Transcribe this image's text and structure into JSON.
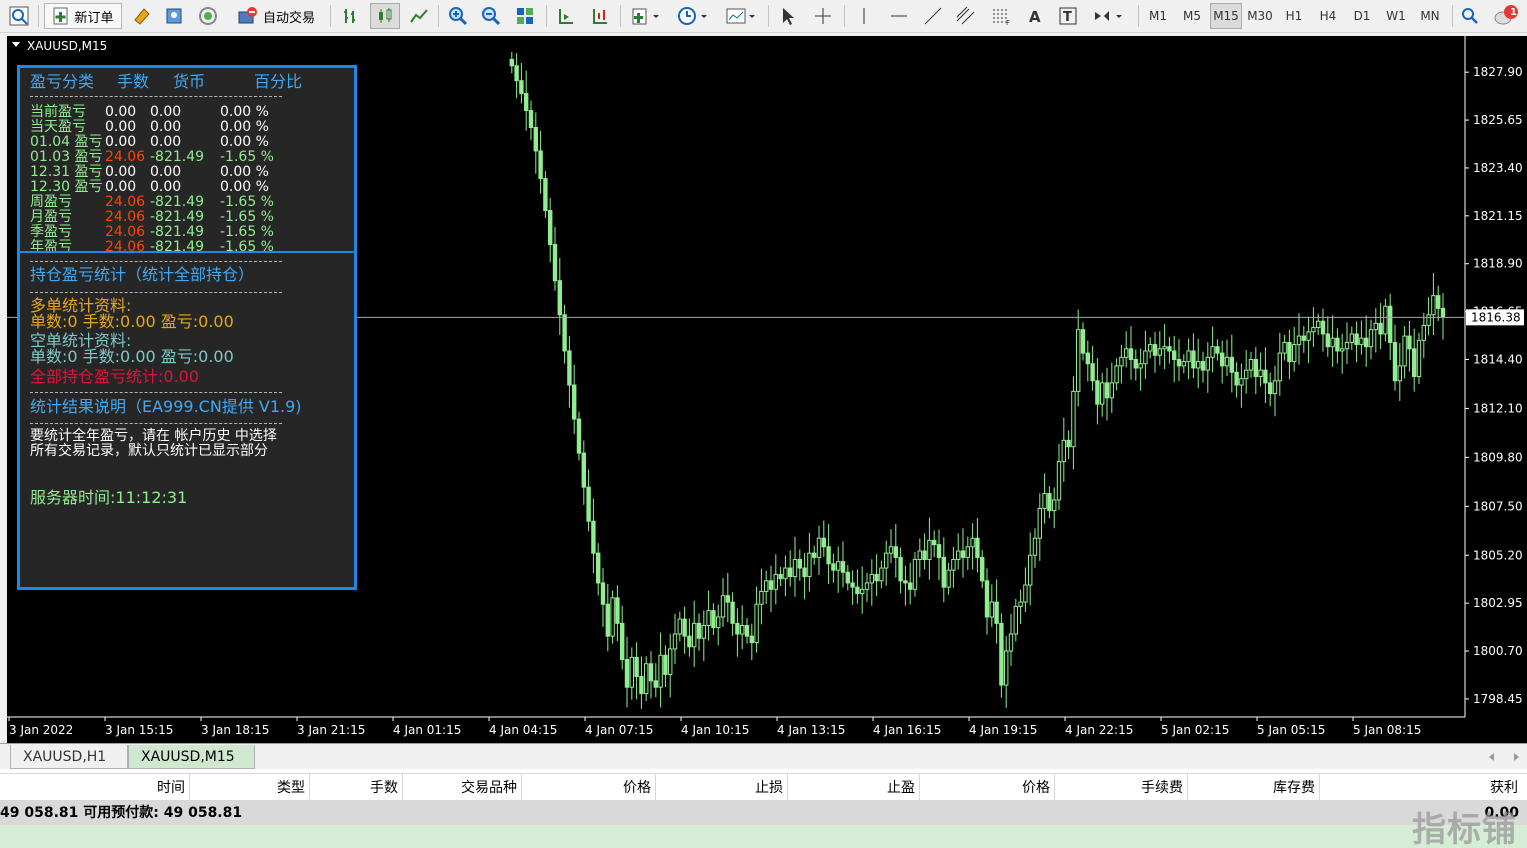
{
  "toolbar": {
    "new_order_label": "新订单",
    "autotrade_label": "自动交易",
    "timeframes": [
      "M1",
      "M5",
      "M15",
      "M30",
      "H1",
      "H4",
      "D1",
      "W1",
      "MN"
    ],
    "active_timeframe": "M15",
    "notification_count": "1"
  },
  "chart": {
    "title": "XAUUSD,M15",
    "current_price": "1816.38",
    "bull_color": "#90ee90",
    "background": "#000000"
  },
  "chart_data": {
    "type": "candlestick",
    "symbol": "XAUUSD",
    "timeframe": "M15",
    "y_ticks": [
      "1827.90",
      "1825.65",
      "1823.40",
      "1821.15",
      "1818.90",
      "1816.65",
      "1814.40",
      "1812.10",
      "1809.80",
      "1807.50",
      "1805.20",
      "1802.95",
      "1800.70",
      "1798.45"
    ],
    "x_ticks": [
      "3 Jan 2022",
      "3 Jan 15:15",
      "3 Jan 18:15",
      "3 Jan 21:15",
      "4 Jan 01:15",
      "4 Jan 04:15",
      "4 Jan 07:15",
      "4 Jan 10:15",
      "4 Jan 13:15",
      "4 Jan 16:15",
      "4 Jan 19:15",
      "4 Jan 22:15",
      "5 Jan 02:15",
      "5 Jan 05:15",
      "5 Jan 08:15"
    ],
    "ylim": [
      1797.6,
      1829.6
    ],
    "last_price": 1816.38,
    "closes": [
      1828.2,
      1827.5,
      1826.9,
      1826.1,
      1825.3,
      1824.2,
      1822.9,
      1821.4,
      1819.8,
      1818.1,
      1816.5,
      1814.8,
      1813.2,
      1811.6,
      1810.0,
      1808.4,
      1806.8,
      1805.3,
      1803.9,
      1802.9,
      1801.4,
      1803.2,
      1802.0,
      1800.3,
      1799.0,
      1800.4,
      1799.5,
      1798.7,
      1800.1,
      1799.3,
      1799.0,
      1800.5,
      1799.6,
      1800.8,
      1801.5,
      1802.2,
      1801.4,
      1800.9,
      1802.0,
      1801.3,
      1801.9,
      1802.6,
      1801.8,
      1802.3,
      1803.3,
      1803.0,
      1802.0,
      1801.5,
      1801.9,
      1801.4,
      1801.1,
      1802.9,
      1803.5,
      1804.0,
      1803.6,
      1804.3,
      1804.1,
      1804.6,
      1804.2,
      1805.0,
      1804.6,
      1804.2,
      1805.3,
      1805.1,
      1806.0,
      1805.6,
      1804.8,
      1804.5,
      1804.9,
      1804.4,
      1803.9,
      1803.7,
      1803.4,
      1803.6,
      1803.9,
      1804.3,
      1804.0,
      1804.6,
      1805.3,
      1805.6,
      1805.1,
      1804.0,
      1803.9,
      1803.6,
      1805.0,
      1805.4,
      1805.0,
      1805.9,
      1805.7,
      1805.1,
      1803.7,
      1804.5,
      1805.0,
      1805.4,
      1805.1,
      1805.6,
      1806.0,
      1805.1,
      1804.0,
      1802.3,
      1803.0,
      1802.0,
      1799.1,
      1800.7,
      1801.5,
      1802.8,
      1803.0,
      1803.8,
      1805.2,
      1806.0,
      1807.4,
      1808.1,
      1807.3,
      1807.8,
      1809.6,
      1810.6,
      1810.3,
      1812.9,
      1815.8,
      1814.7,
      1814.2,
      1813.4,
      1812.3,
      1813.3,
      1812.6,
      1813.3,
      1814.1,
      1814.5,
      1814.9,
      1814.4,
      1814.0,
      1814.2,
      1814.8,
      1815.1,
      1814.6,
      1814.9,
      1815.0,
      1814.8,
      1814.4,
      1814.1,
      1814.3,
      1814.8,
      1814.0,
      1814.3,
      1813.9,
      1814.5,
      1815.0,
      1814.7,
      1814.1,
      1814.5,
      1813.8,
      1813.2,
      1813.5,
      1813.9,
      1814.4,
      1813.6,
      1813.9,
      1813.3,
      1812.8,
      1813.4,
      1814.7,
      1815.2,
      1814.3,
      1815.1,
      1815.5,
      1815.3,
      1815.7,
      1815.9,
      1816.2,
      1815.6,
      1815.0,
      1815.4,
      1814.8,
      1814.9,
      1815.2,
      1815.6,
      1815.1,
      1815.4,
      1815.0,
      1815.8,
      1816.1,
      1815.6,
      1816.9,
      1815.2,
      1813.4,
      1814.1,
      1815.5,
      1814.9,
      1813.6,
      1815.3,
      1816.0,
      1816.5,
      1817.4,
      1816.8,
      1816.4
    ]
  },
  "ea_panel": {
    "pnl_header": [
      "盈亏分类",
      "手数",
      "货币",
      "百分比"
    ],
    "pnl_rows": [
      {
        "label": "当前盈亏",
        "lots": "0.00",
        "money": "0.00",
        "pct": "0.00 %",
        "lots_neg": false
      },
      {
        "label": "当天盈亏",
        "lots": "0.00",
        "money": "0.00",
        "pct": "0.00 %",
        "lots_neg": false
      },
      {
        "label": "01.04 盈亏",
        "lots": "0.00",
        "money": "0.00",
        "pct": "0.00 %",
        "lots_neg": false
      },
      {
        "label": "01.03 盈亏",
        "lots": "24.06",
        "money": "-821.49",
        "pct": "-1.65 %",
        "lots_neg": true
      },
      {
        "label": "12.31 盈亏",
        "lots": "0.00",
        "money": "0.00",
        "pct": "0.00 %",
        "lots_neg": false
      },
      {
        "label": "12.30 盈亏",
        "lots": "0.00",
        "money": "0.00",
        "pct": "0.00 %",
        "lots_neg": false
      },
      {
        "label": "周盈亏",
        "lots": "24.06",
        "money": "-821.49",
        "pct": "-1.65 %",
        "lots_neg": true
      },
      {
        "label": "月盈亏",
        "lots": "24.06",
        "money": "-821.49",
        "pct": "-1.65 %",
        "lots_neg": true
      },
      {
        "label": "季盈亏",
        "lots": "24.06",
        "money": "-821.49",
        "pct": "-1.65 %",
        "lots_neg": true
      },
      {
        "label": "年盈亏",
        "lots": "24.06",
        "money": "-821.49",
        "pct": "-1.65 %",
        "lots_neg": true
      }
    ],
    "position_title": "持仓盈亏统计（统计全部持仓）",
    "long_title": "多单统计资料:",
    "long_stats": "单数:0   手数:0.00 盈亏:0.00",
    "short_title": "空单统计资料:",
    "short_stats": "单数:0   手数:0.00 盈亏:0.00",
    "all_stats": "全部持仓盈亏统计:0.00",
    "note_title": "统计结果说明（EA999.CN提供 V1.9)",
    "note_line1": "要统计全年盈亏，请在 帐户历史 中选择",
    "note_line2": "所有交易记录，默认只统计已显示部分",
    "server_time": "服务器时间:11:12:31"
  },
  "tabs": [
    {
      "label": "XAUUSD,H1",
      "active": false
    },
    {
      "label": "XAUUSD,M15",
      "active": true
    }
  ],
  "terminal": {
    "columns": [
      "时间",
      "类型",
      "手数",
      "交易品种",
      "价格",
      "止损",
      "止盈",
      "价格",
      "手续费",
      "库存费",
      "获利"
    ],
    "balance_row": "49 058.81  可用预付款: 49 058.81",
    "profit_value": "0.00"
  },
  "watermark": "指标铺"
}
